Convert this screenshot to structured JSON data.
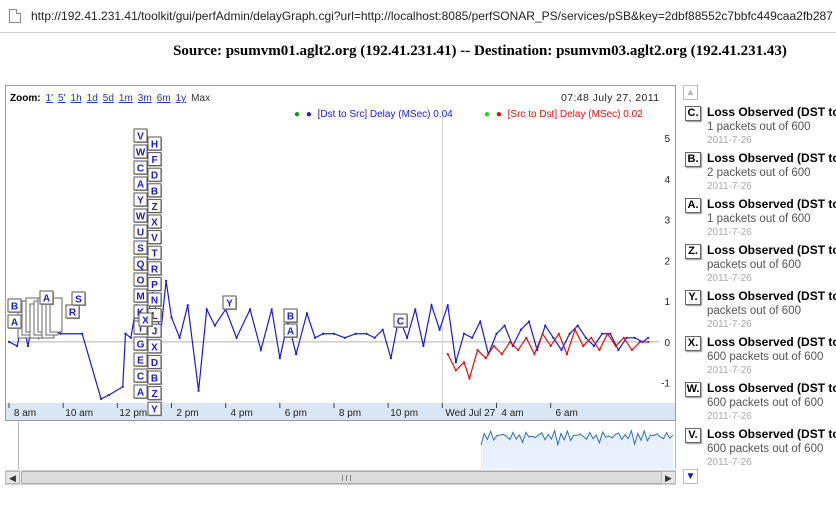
{
  "browser": {
    "url": "http://192.41.231.41/toolkit/gui/perfAdmin/delayGraph.cgi?url=http://localhost:8085/perfSONAR_PS/services/pSB&key=2dbf88552c7bbfc449caa2fb287"
  },
  "page_title": "Source: psumvm01.aglt2.org (192.41.231.41) -- Destination: psumvm03.aglt2.org (192.41.231.43)",
  "graph": {
    "zoom_label": "Zoom:",
    "zoom_options": [
      "1'",
      "5'",
      "1h",
      "1d",
      "5d",
      "1m",
      "3m",
      "6m",
      "1y"
    ],
    "zoom_max": "Max",
    "timestamp": "07:48 July 27, 2011",
    "legend": [
      {
        "bullet": "●",
        "label": "[Dst to Src] Delay (MSec) 0.04",
        "color": "#1a1ad6",
        "dot_color": "#1a8c1a"
      },
      {
        "bullet": "●",
        "label": "[Src to Dst] Delay (MSec) 0.02",
        "color": "#e01010",
        "dot_color": "#1ad61a"
      }
    ]
  },
  "chart_data": {
    "type": "line",
    "x_tick_labels": [
      "8 am",
      "10 am",
      "12 pm",
      "2 pm",
      "4 pm",
      "6 pm",
      "8 pm",
      "10 pm",
      "Wed Jul 27",
      "4 am",
      "6 am"
    ],
    "y_tick_labels": [
      "5",
      "4",
      "3",
      "2",
      "1",
      "0",
      "-1"
    ],
    "ylim": [
      -1.5,
      5.3
    ],
    "grid": true,
    "legend_position": "top-right",
    "series": [
      {
        "name": "[Dst to Src] Delay (MSec) 0.04",
        "color": "#1a1ad6",
        "x": [
          0,
          0.3,
          0.5,
          0.7,
          0.9,
          1.1,
          1.3,
          1.5,
          1.9,
          2.7,
          3.4,
          3.7,
          4.2,
          4.3,
          4.5,
          4.7,
          5.0,
          5.3,
          5.6,
          5.8,
          6.0,
          6.3,
          6.6,
          7.0,
          7.3,
          7.6,
          8.0,
          8.4,
          8.9,
          9.3,
          9.7,
          10.0,
          10.3,
          10.6,
          11.0,
          11.3,
          11.6,
          12.0,
          12.4,
          12.8,
          13.2,
          13.5,
          13.8,
          14.1,
          14.4,
          14.7,
          15.0,
          15.3,
          15.6,
          15.9,
          16.2,
          16.5,
          16.8,
          17.1,
          17.4,
          17.7,
          18.0,
          18.3,
          18.6,
          18.9,
          19.2,
          19.5,
          19.8,
          20.1,
          20.4,
          20.7,
          21.0,
          21.3,
          21.6,
          21.9,
          22.2,
          22.5,
          22.8,
          23.1,
          23.4,
          23.6
        ],
        "y": [
          0,
          -0.1,
          0.5,
          -0.1,
          0.6,
          0.1,
          0.6,
          0.3,
          0.2,
          0.2,
          -1.4,
          -1.3,
          -1.1,
          0.2,
          0.1,
          0.9,
          0.2,
          1.2,
          0.2,
          1.5,
          0.6,
          0.1,
          0.9,
          -1.2,
          0.8,
          0.4,
          0.8,
          0.1,
          0.8,
          -0.2,
          0.8,
          -0.4,
          0.5,
          -0.3,
          0.7,
          0.1,
          0.2,
          0.2,
          0.1,
          0.2,
          0.2,
          0.1,
          0.3,
          -0.4,
          0.6,
          0.1,
          0.8,
          -0.1,
          0.9,
          0.3,
          0.9,
          -0.5,
          0.2,
          0.1,
          0.5,
          -0.3,
          0.2,
          0.4,
          -0.1,
          0.3,
          0.5,
          -0.2,
          0.4,
          0.1,
          -0.2,
          0.2,
          0.4,
          0.1,
          -0.1,
          0.2,
          0.2,
          -0.2,
          0.1,
          0.1,
          0.0,
          0.1
        ]
      },
      {
        "name": "[Src to Dst] Delay (MSec) 0.02",
        "color": "#e01010",
        "x": [
          16.2,
          16.5,
          16.8,
          17.0,
          17.3,
          17.6,
          17.9,
          18.2,
          18.5,
          18.8,
          19.1,
          19.4,
          19.7,
          20.0,
          20.3,
          20.6,
          20.9,
          21.2,
          21.5,
          21.8,
          22.1,
          22.4,
          22.7,
          23.0,
          23.3,
          23.6
        ],
        "y": [
          -0.3,
          -0.7,
          -0.5,
          -0.9,
          -0.2,
          -0.4,
          -0.1,
          -0.3,
          0.0,
          -0.2,
          0.1,
          -0.3,
          0.2,
          -0.1,
          0.2,
          -0.3,
          0.3,
          -0.1,
          0.1,
          -0.2,
          0.2,
          -0.1,
          0.1,
          -0.2,
          0.0,
          0.0
        ]
      }
    ]
  },
  "annotations": [
    {
      "letter": "C.",
      "title": "Loss Observed (DST to",
      "detail": "1 packets out of 600",
      "date": "2011-7-26"
    },
    {
      "letter": "B.",
      "title": "Loss Observed (DST to",
      "detail": "2 packets out of 600",
      "date": "2011-7-26"
    },
    {
      "letter": "A.",
      "title": "Loss Observed (DST to",
      "detail": "1 packets out of 600",
      "date": "2011-7-26"
    },
    {
      "letter": "Z.",
      "title": "Loss Observed (DST to",
      "detail": "packets out of 600",
      "date": "2011-7-26"
    },
    {
      "letter": "Y.",
      "title": "Loss Observed (DST to",
      "detail": "packets out of 600",
      "date": "2011-7-26"
    },
    {
      "letter": "X.",
      "title": "Loss Observed (DST to",
      "detail": "600 packets out of 600",
      "date": "2011-7-26"
    },
    {
      "letter": "W.",
      "title": "Loss Observed (DST to",
      "detail": "600 packets out of 600",
      "date": "2011-7-26"
    },
    {
      "letter": "V.",
      "title": "Loss Observed (DST to",
      "detail": "600 packets out of 600",
      "date": "2011-7-26"
    }
  ],
  "flag_letters": {
    "left_cluster": [
      "B",
      "A",
      "A",
      "R",
      "S"
    ],
    "column_1": [
      "V",
      "W",
      "C",
      "A",
      "Y",
      "W",
      "U",
      "S",
      "Q",
      "O",
      "M",
      "K",
      "I",
      "G",
      "E",
      "C",
      "A"
    ],
    "column_2": [
      "H",
      "F",
      "D",
      "B",
      "Z",
      "X",
      "V",
      "T",
      "R",
      "P",
      "N",
      "L",
      "J",
      "X",
      "D",
      "B",
      "Z",
      "Y"
    ],
    "markers": [
      "Y",
      "B",
      "A",
      "C"
    ]
  },
  "scrollbar": {
    "left_arrow": "◀",
    "right_arrow": "▶",
    "up_arrow": "▲",
    "down_arrow": "▼"
  }
}
